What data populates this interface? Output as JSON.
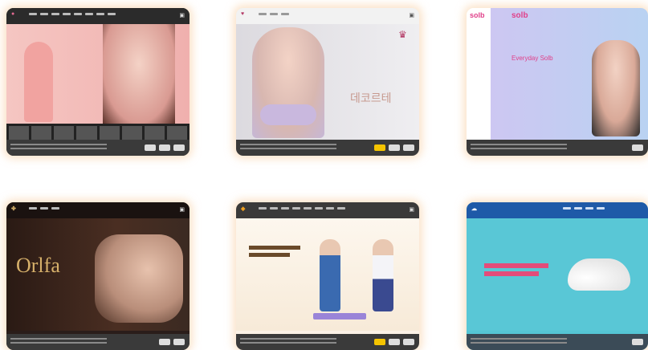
{
  "cards": [
    {
      "brand": "",
      "hero_text": "",
      "colors": {
        "bg": "#f2b8b6",
        "accent": "#e46a92"
      }
    },
    {
      "brand": "",
      "hero_text": "데코르테",
      "colors": {
        "bg": "#e8e6ea",
        "accent": "#b43a66"
      }
    },
    {
      "brand": "solb",
      "hero_text": "Everyday Solb",
      "colors": {
        "bg": "#c9c4ef",
        "accent": "#e0408a"
      }
    },
    {
      "brand": "",
      "hero_text": "Orlfa",
      "colors": {
        "bg": "#2a1d1a",
        "accent": "#d6b06a"
      }
    },
    {
      "brand": "",
      "hero_text": "",
      "colors": {
        "bg": "#fbf2e6",
        "accent": "#f0a020"
      }
    },
    {
      "brand": "",
      "hero_text": "",
      "colors": {
        "bg": "#55c5d4",
        "accent": "#e34c7a"
      }
    }
  ]
}
